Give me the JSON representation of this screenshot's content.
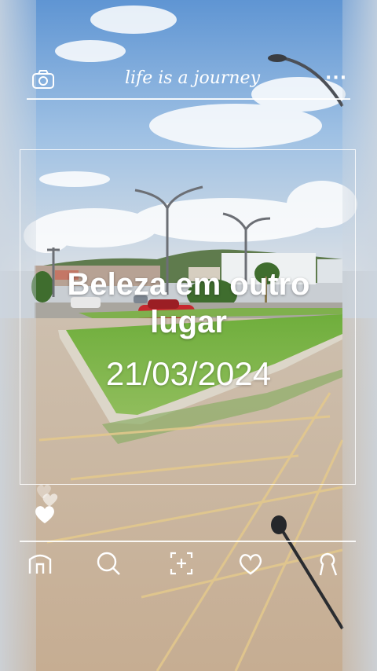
{
  "header": {
    "title": "life is a journey",
    "camera_icon": "camera-icon",
    "more_icon": "more-dots-icon",
    "more_label": "···"
  },
  "post": {
    "caption": "Beleza em outro lugar",
    "date": "21/03/2024"
  },
  "nav": {
    "items": [
      {
        "icon": "home-icon"
      },
      {
        "icon": "search-icon"
      },
      {
        "icon": "add-post-icon"
      },
      {
        "icon": "heart-icon"
      },
      {
        "icon": "profile-icon"
      }
    ]
  },
  "colors": {
    "overlay_white": "#ffffff",
    "sky": "#7fb0df",
    "grass": "#7ab34a",
    "road": "#c7b49e",
    "car": "#c6282f"
  }
}
